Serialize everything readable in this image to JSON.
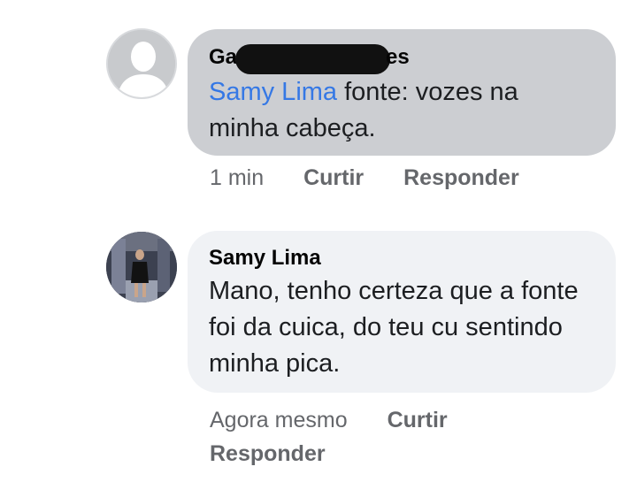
{
  "comments": [
    {
      "author_visible_start": "Ga",
      "author_visible_end": "es",
      "author_redacted": true,
      "mention": "Samy Lima",
      "text_after_mention": " fonte: vozes na minha cabeça.",
      "time": "1 min",
      "like_label": "Curtir",
      "reply_label": "Responder",
      "avatar": "default-profile-silhouette-icon"
    },
    {
      "author": "Samy Lima",
      "text": "Mano, tenho certeza que a fonte foi da cuica, do teu cu sentindo minha pica.",
      "time": "Agora mesmo",
      "like_label": "Curtir",
      "reply_label": "Responder",
      "avatar": "profile-photo"
    }
  ],
  "colors": {
    "mention": "#3578e5",
    "bubble_first": "#ccced2",
    "bubble_second": "#f0f2f5",
    "meta_text": "#65676b",
    "redaction": "#111111"
  }
}
